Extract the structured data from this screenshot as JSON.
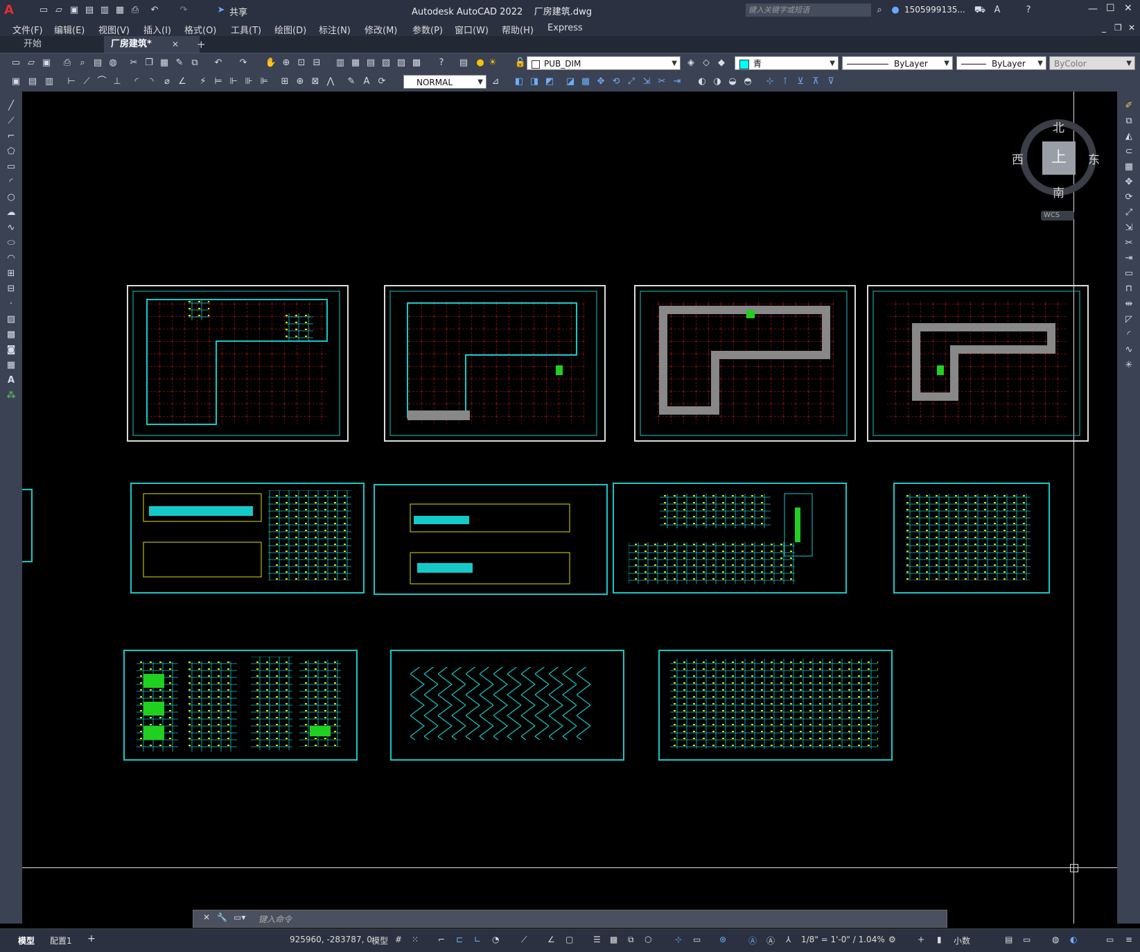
{
  "titlebar": {
    "app_icon": "A",
    "title": "Autodesk AutoCAD 2022    厂房建筑.dwg",
    "share_label": "共享",
    "search_placeholder": "键入关键字或短语",
    "user": "1505999135...",
    "minimize": "—",
    "maximize": "☐",
    "close": "✕"
  },
  "menu": [
    "文件(F)",
    "编辑(E)",
    "视图(V)",
    "插入(I)",
    "格式(O)",
    "工具(T)",
    "绘图(D)",
    "标注(N)",
    "修改(M)",
    "参数(P)",
    "窗口(W)",
    "帮助(H)",
    "Express"
  ],
  "tabs": {
    "start": "开始",
    "doc": "厂房建筑*",
    "close": "✕",
    "add": "+"
  },
  "toolbar": {
    "layer": "PUB_DIM",
    "color": "青",
    "linetype": "ByLayer",
    "lineweight": "ByLayer",
    "plotstyle": "ByColor",
    "dimstyle": "NORMAL"
  },
  "viewcube": {
    "north": "北",
    "south": "南",
    "east": "东",
    "west": "西",
    "top": "上",
    "wcs": "WCS"
  },
  "command": {
    "placeholder": "键入命令"
  },
  "status": {
    "model_tab": "模型",
    "layout_tab": "配置1",
    "add_tab": "+",
    "coords": "925960, -283787, 0",
    "mode": "模型",
    "scale": "1/8\" = 1'-0\" / 1.04%",
    "units": "小数"
  },
  "colors": {
    "cyan": "#16c9c9",
    "red_grid": "#c81818",
    "accent_blue": "#2b6cd1"
  }
}
